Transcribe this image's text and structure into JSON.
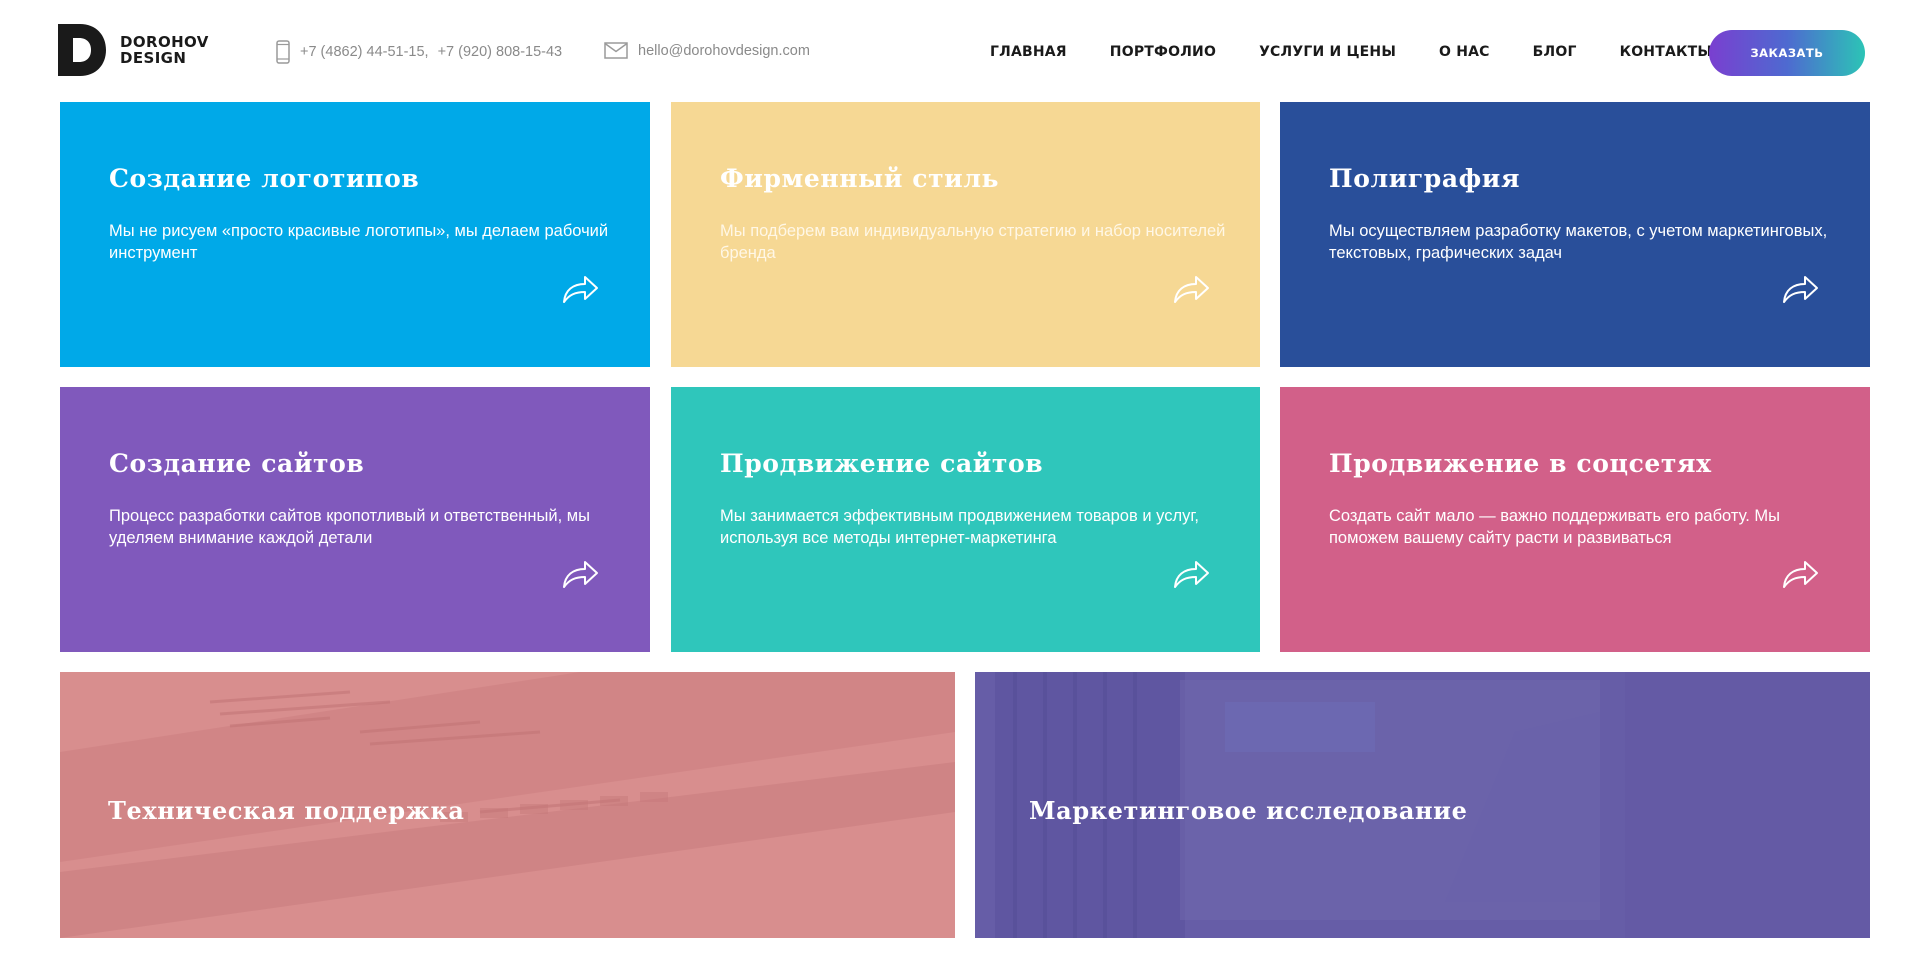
{
  "header": {
    "logo": {
      "line1": "DOROHOV",
      "line2": "DESIGN"
    },
    "phones": {
      "phone1": "+7 (4862) 44-51-15,",
      "phone2": "+7 (920) 808-15-43"
    },
    "email": "hello@dorohovdesign.com",
    "nav": [
      {
        "label": "ГЛАВНАЯ"
      },
      {
        "label": "ПОРТФОЛИО"
      },
      {
        "label": "УСЛУГИ И ЦЕНЫ"
      },
      {
        "label": "О НАС"
      },
      {
        "label": "БЛОГ"
      },
      {
        "label": "КОНТАКТЫ"
      }
    ],
    "order_button": "ЗАКАЗАТЬ"
  },
  "services": [
    {
      "title": "Создание логотипов",
      "description": "Мы не рисуем «просто красивые логотипы», мы делаем рабочий инструмент",
      "color": "#00a9e8"
    },
    {
      "title": "Фирменный стиль",
      "description": "Мы подберем вам индивидуальную стратегию и набор носителей бренда",
      "color": "#f6d894"
    },
    {
      "title": "Полиграфия",
      "description": "Мы осуществляем разработку макетов, с учетом маркетинговых, текстовых, графических задач",
      "color": "#294f9a"
    },
    {
      "title": "Создание сайтов",
      "description": "Процесс разработки сайтов кропотливый и ответственный, мы уделяем внимание каждой детали",
      "color": "#8059bc"
    },
    {
      "title": "Продвижение сайтов",
      "description": "Мы занимается эффективным продвижением товаров и услуг, используя все методы интернет-маркетинга",
      "color": "#2fc6bb"
    },
    {
      "title": "Продвижение в соцсетях",
      "description": "Создать сайт мало — важно поддерживать его работу. Мы поможем вашему сайту расти и развиваться",
      "color": "#d26089"
    },
    {
      "title": "Техническая поддержка",
      "color": "#d4898a"
    },
    {
      "title": "Маркетинговое исследование",
      "color": "#655ca6"
    }
  ],
  "icons": {
    "phone": "phone-icon",
    "email": "mail-icon",
    "arrow": "share-arrow-icon"
  }
}
